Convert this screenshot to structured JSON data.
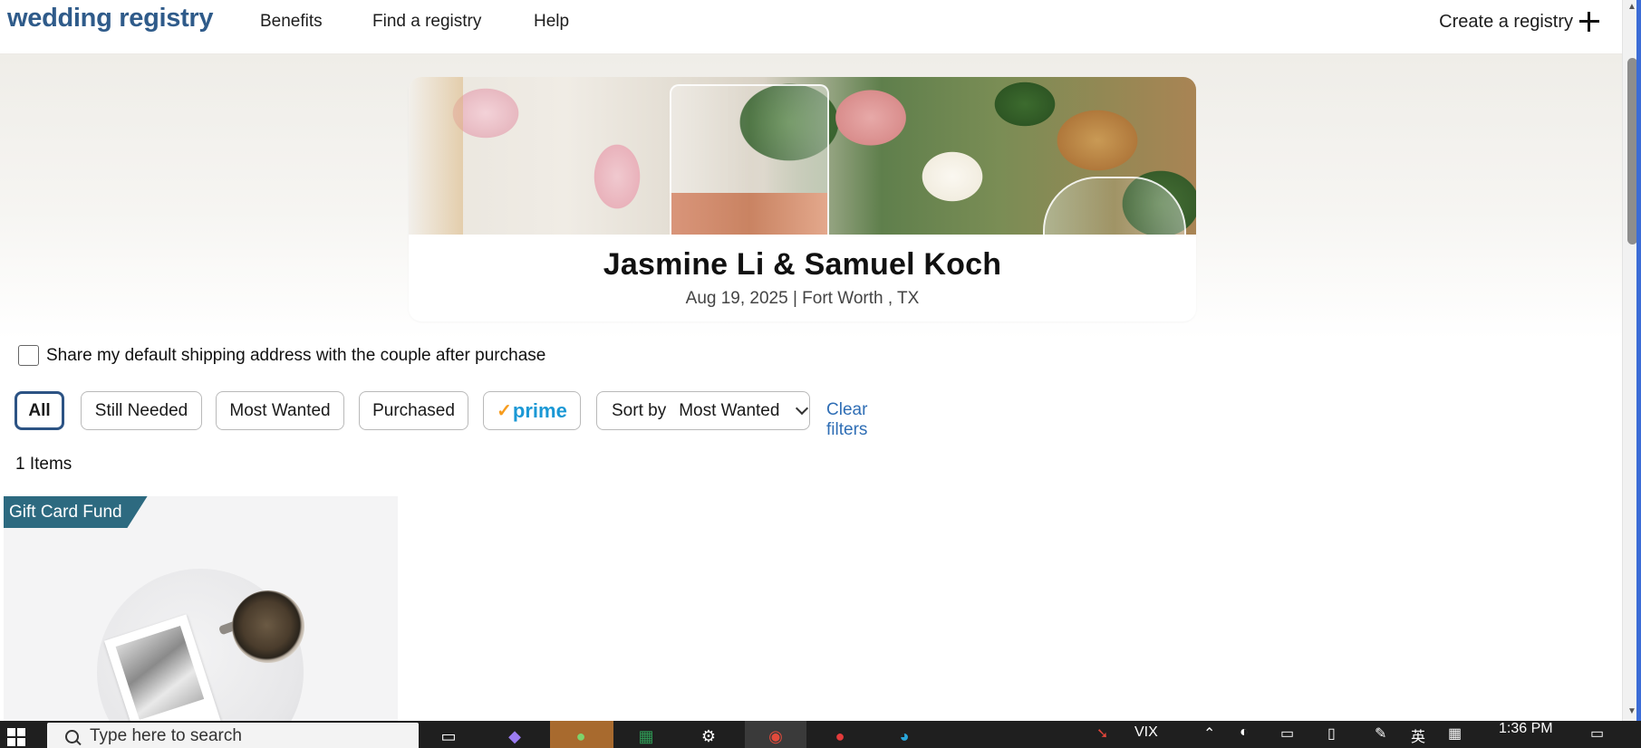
{
  "header": {
    "logo": "wedding registry",
    "nav": [
      "Benefits",
      "Find a registry",
      "Help"
    ],
    "create_label": "Create a registry"
  },
  "registry": {
    "couple": "Jasmine Li & Samuel Koch",
    "event_info": "Aug 19, 2025 | Fort Worth , TX"
  },
  "share_label": "Share my default shipping address with the couple after purchase",
  "filters": {
    "all": "All",
    "still_needed": "Still Needed",
    "most_wanted": "Most Wanted",
    "purchased": "Purchased",
    "prime": "prime",
    "sort_label": "Sort by",
    "sort_value": "Most Wanted",
    "clear": "Clear filters"
  },
  "item_count": "1 Items",
  "product": {
    "tag": "Gift Card Fund"
  },
  "taskbar": {
    "search_placeholder": "Type here to search",
    "tray_text": "VIX",
    "ime": "英",
    "time": "1:36 PM"
  }
}
